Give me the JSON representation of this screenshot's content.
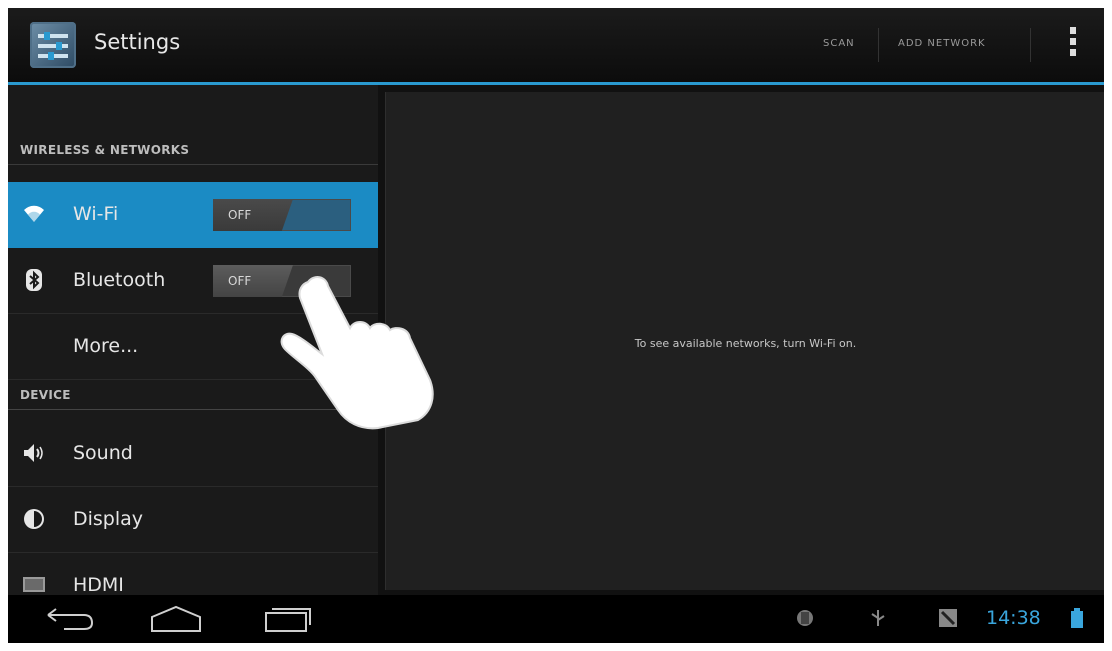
{
  "action_bar": {
    "title": "Settings",
    "scan_label": "SCAN",
    "add_network_label": "ADD NETWORK"
  },
  "sections": [
    {
      "header": "WIRELESS & NETWORKS"
    },
    {
      "header": "DEVICE"
    }
  ],
  "items": {
    "wifi": {
      "label": "Wi-Fi",
      "toggle": "OFF",
      "icon": "wifi-icon",
      "selected": true
    },
    "bluetooth": {
      "label": "Bluetooth",
      "toggle": "OFF",
      "icon": "bluetooth-icon"
    },
    "more": {
      "label": "More..."
    },
    "sound": {
      "label": "Sound",
      "icon": "speaker-icon"
    },
    "display": {
      "label": "Display",
      "icon": "brightness-icon"
    },
    "hdmi": {
      "label": "HDMI",
      "icon": "hdmi-icon"
    }
  },
  "detail": {
    "message": "To see available networks, turn Wi-Fi on."
  },
  "status_bar": {
    "time": "14:38"
  },
  "colors": {
    "accent": "#1b8bc4",
    "clock": "#3aa6dd"
  }
}
